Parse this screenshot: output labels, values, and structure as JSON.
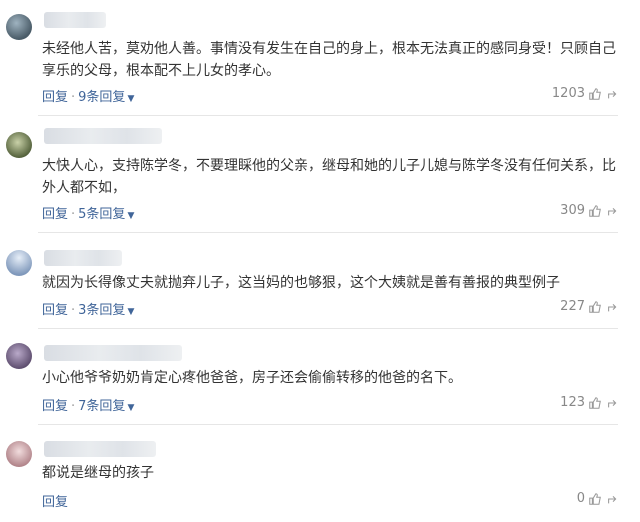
{
  "comments": [
    {
      "text": "未经他人苦，莫劝他人善。事情没有发生在自己的身上，根本无法真正的感同身受！只顾自己享乐的父母，根本配不上儿女的孝心。",
      "reply_label": "回复",
      "replies_label": "9条回复",
      "likes": "1203",
      "avatar_color": "#5a6f7c"
    },
    {
      "text": "大快人心，支持陈学冬，不要理睬他的父亲，继母和她的儿子儿媳与陈学冬没有任何关系，比外人都不如，",
      "reply_label": "回复",
      "replies_label": "5条回复",
      "likes": "309",
      "avatar_color": "#6b7a52"
    },
    {
      "text": "就因为长得像丈夫就抛弃儿子，这当妈的也够狠，这个大姨就是善有善报的典型例子",
      "reply_label": "回复",
      "replies_label": "3条回复",
      "likes": "227",
      "avatar_color": "#8fa6c4"
    },
    {
      "text": "小心他爷爷奶奶肯定心疼他爸爸，房子还会偷偷转移的他爸的名下。",
      "reply_label": "回复",
      "replies_label": "7条回复",
      "likes": "123",
      "avatar_color": "#7d6e8c"
    },
    {
      "text": "都说是继母的孩子",
      "reply_label": "回复",
      "likes": "0",
      "avatar_color": "#c7a3a7"
    }
  ],
  "colors": {
    "link": "#406599",
    "text": "#333333",
    "muted": "#888888"
  },
  "icons": {
    "like": "thumbs-up-icon",
    "share": "share-icon"
  }
}
